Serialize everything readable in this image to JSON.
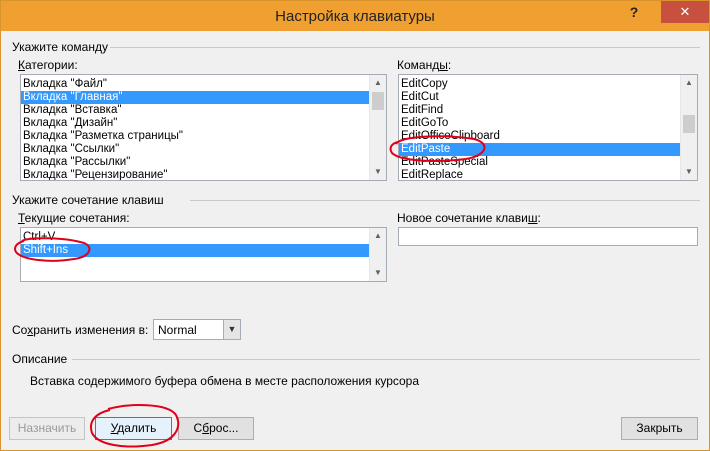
{
  "window": {
    "title": "Настройка клавиатуры",
    "help_glyph": "?",
    "close_glyph": "✕"
  },
  "command_section": {
    "heading": "Укажите команду",
    "categories_label_mnemonic": "К",
    "categories_label_rest": "атегории:",
    "categories": [
      "Вкладка \"Файл\"",
      "Вкладка \"Главная\"",
      "Вкладка \"Вставка\"",
      "Вкладка \"Дизайн\"",
      "Вкладка \"Разметка страницы\"",
      "Вкладка \"Ссылки\"",
      "Вкладка \"Рассылки\"",
      "Вкладка \"Рецензирование\""
    ],
    "categories_selected": "Вкладка \"Главная\"",
    "commands_label_start": "Команд",
    "commands_label_mnemonic": "ы",
    "commands_label_end": ":",
    "commands": [
      "EditCopy",
      "EditCut",
      "EditFind",
      "EditGoTo",
      "EditOfficeClipboard",
      "EditPaste",
      "EditPasteSpecial",
      "EditReplace"
    ],
    "commands_selected": "EditPaste"
  },
  "shortcut_section": {
    "heading": "Укажите сочетание клавиш",
    "current_label_mnemonic": "Т",
    "current_label_rest": "екущие сочетания:",
    "current_keys": [
      "Ctrl+V",
      "Shift+Ins"
    ],
    "current_selected": "Shift+Ins",
    "new_label_start": "Новое сочетание клави",
    "new_label_mnemonic": "ш",
    "new_label_end": ":",
    "new_value": ""
  },
  "save": {
    "label_start": "Со",
    "label_mnemonic": "х",
    "label_end": "ранить изменения в:",
    "selected": "Normal"
  },
  "description": {
    "heading": "Описание",
    "text": "Вставка содержимого буфера обмена в месте расположения курсора"
  },
  "buttons": {
    "assign": "Назначить",
    "delete_mnemonic": "У",
    "delete_rest": "далить",
    "reset_start": "С",
    "reset_mnemonic": "б",
    "reset_end": "рос...",
    "close": "Закрыть"
  },
  "colors": {
    "titlebar": "#f0a030",
    "close": "#c7503f",
    "selection": "#3399ff",
    "annotation": "#e0001b"
  }
}
